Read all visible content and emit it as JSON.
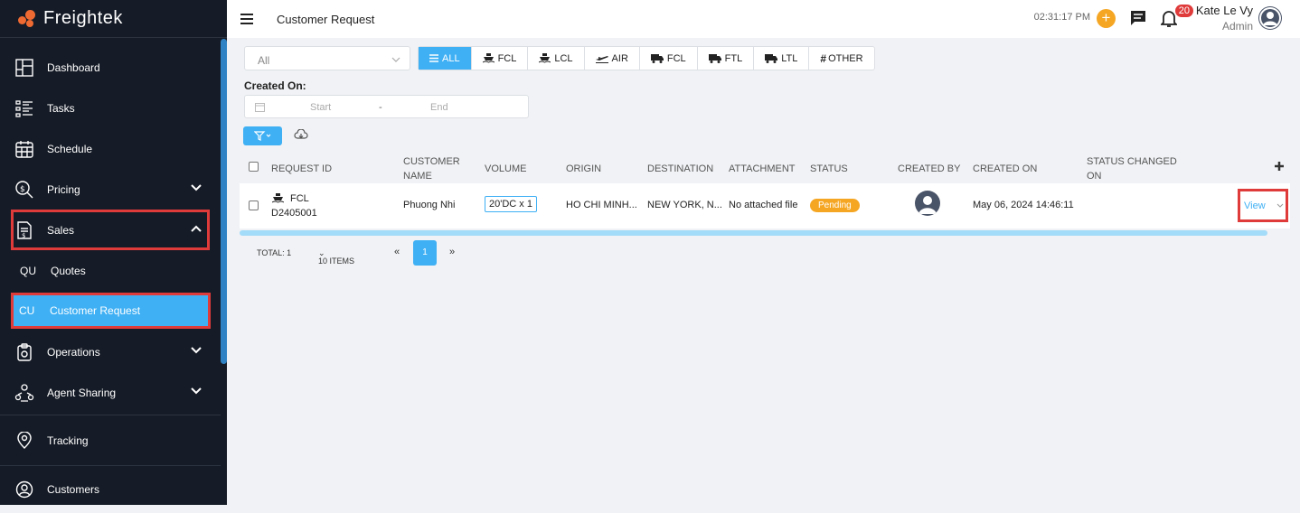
{
  "app": {
    "brand": "Freightek"
  },
  "sidebar": {
    "items": [
      {
        "label": "Dashboard",
        "icon": "dashboard-icon"
      },
      {
        "label": "Tasks",
        "icon": "tasks-icon"
      },
      {
        "label": "Schedule",
        "icon": "calendar-icon"
      },
      {
        "label": "Pricing",
        "icon": "pricing-icon"
      },
      {
        "label": "Sales",
        "icon": "sales-icon"
      },
      {
        "label": "Quotes",
        "abbr": "QU"
      },
      {
        "label": "Customer Request",
        "abbr": "CU"
      },
      {
        "label": "Operations",
        "icon": "operations-icon"
      },
      {
        "label": "Agent Sharing",
        "icon": "agent-sharing-icon"
      },
      {
        "label": "Tracking",
        "icon": "tracking-icon"
      },
      {
        "label": "Customers",
        "icon": "customers-icon"
      }
    ]
  },
  "header": {
    "title": "Customer Request",
    "time": "02:31:17 PM",
    "notification_count": "20",
    "user_name": "Kate Le Vy",
    "user_role": "Admin"
  },
  "filters": {
    "select_value": "All",
    "tabs": [
      "ALL",
      "FCL",
      "LCL",
      "AIR",
      "FCL",
      "FTL",
      "LTL",
      "OTHER"
    ],
    "created_on_label": "Created On:",
    "start_placeholder": "Start",
    "end_placeholder": "End",
    "range_sep": "-"
  },
  "table": {
    "headers": [
      "REQUEST ID",
      "CUSTOMER NAME",
      "VOLUME",
      "ORIGIN",
      "DESTINATION",
      "ATTACHMENT",
      "STATUS",
      "CREATED BY",
      "CREATED ON",
      "STATUS CHANGED ON"
    ],
    "rows": [
      {
        "type": "FCL",
        "request_id": "D2405001",
        "customer_name": "Phuong Nhi",
        "volume": "20'DC x 1",
        "origin": "HO CHI MINH...",
        "destination": "NEW YORK, N...",
        "attachment": "No attached file",
        "status": "Pending",
        "created_on": "May 06, 2024 14:46:11",
        "status_changed_on": "",
        "action": "View"
      }
    ]
  },
  "pagination": {
    "total": "TOTAL: 1",
    "page_size": "10 ITEMS",
    "prev": "«",
    "current": "1",
    "next": "»"
  },
  "colors": {
    "accent": "#3fb0f4",
    "sidebar_bg": "#161c27",
    "pending": "#f5a623",
    "highlight": "#e03b3b"
  }
}
